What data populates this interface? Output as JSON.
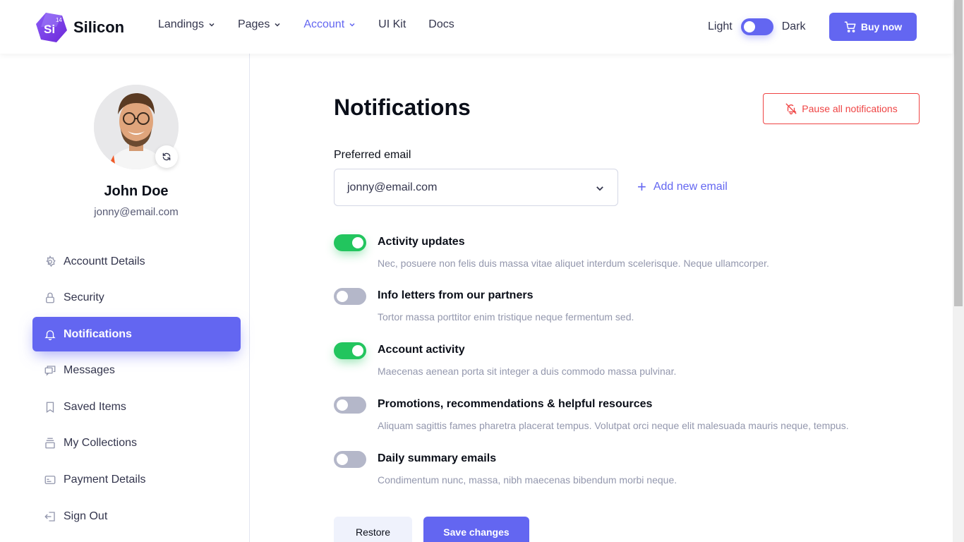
{
  "brand": {
    "name": "Silicon",
    "logo_text": "Si",
    "logo_badge": "14"
  },
  "nav": {
    "items": [
      {
        "label": "Landings",
        "dropdown": true,
        "active": false
      },
      {
        "label": "Pages",
        "dropdown": true,
        "active": false
      },
      {
        "label": "Account",
        "dropdown": true,
        "active": true
      },
      {
        "label": "UI Kit",
        "dropdown": false,
        "active": false
      },
      {
        "label": "Docs",
        "dropdown": false,
        "active": false
      }
    ]
  },
  "mode": {
    "light_label": "Light",
    "dark_label": "Dark"
  },
  "buy_label": "Buy now",
  "user": {
    "name": "John Doe",
    "email": "jonny@email.com"
  },
  "sidebar": {
    "items": [
      {
        "label": "Accountt Details",
        "icon": "gear-icon",
        "active": false
      },
      {
        "label": "Security",
        "icon": "lock-icon",
        "active": false
      },
      {
        "label": "Notifications",
        "icon": "bell-icon",
        "active": true
      },
      {
        "label": "Messages",
        "icon": "chat-icon",
        "active": false
      },
      {
        "label": "Saved Items",
        "icon": "bookmark-icon",
        "active": false
      },
      {
        "label": "My Collections",
        "icon": "collection-icon",
        "active": false
      },
      {
        "label": "Payment Details",
        "icon": "card-icon",
        "active": false
      },
      {
        "label": "Sign Out",
        "icon": "sign-out-icon",
        "active": false
      }
    ]
  },
  "main": {
    "title": "Notifications",
    "pause_label": "Pause all notifications",
    "email_label": "Preferred email",
    "email_value": "jonny@email.com",
    "add_email_label": "Add new email",
    "notifications": [
      {
        "title": "Activity updates",
        "desc": "Nec, posuere non felis duis massa vitae aliquet interdum scelerisque. Neque ullamcorper.",
        "on": true
      },
      {
        "title": "Info letters from our partners",
        "desc": "Tortor massa porttitor enim tristique neque fermentum sed.",
        "on": false
      },
      {
        "title": "Account activity",
        "desc": "Maecenas aenean porta sit integer a duis commodo massa pulvinar.",
        "on": true
      },
      {
        "title": "Promotions, recommendations & helpful resources",
        "desc": "Aliquam sagittis fames pharetra placerat tempus. Volutpat orci neque elit malesuada mauris neque, tempus.",
        "on": false
      },
      {
        "title": "Daily summary emails",
        "desc": "Condimentum nunc, massa, nibh maecenas bibendum morbi neque.",
        "on": false
      }
    ],
    "restore_label": "Restore",
    "save_label": "Save changes"
  },
  "colors": {
    "primary": "#6366f1",
    "success": "#22c55e",
    "danger": "#ef4444",
    "muted": "#9397ad"
  }
}
